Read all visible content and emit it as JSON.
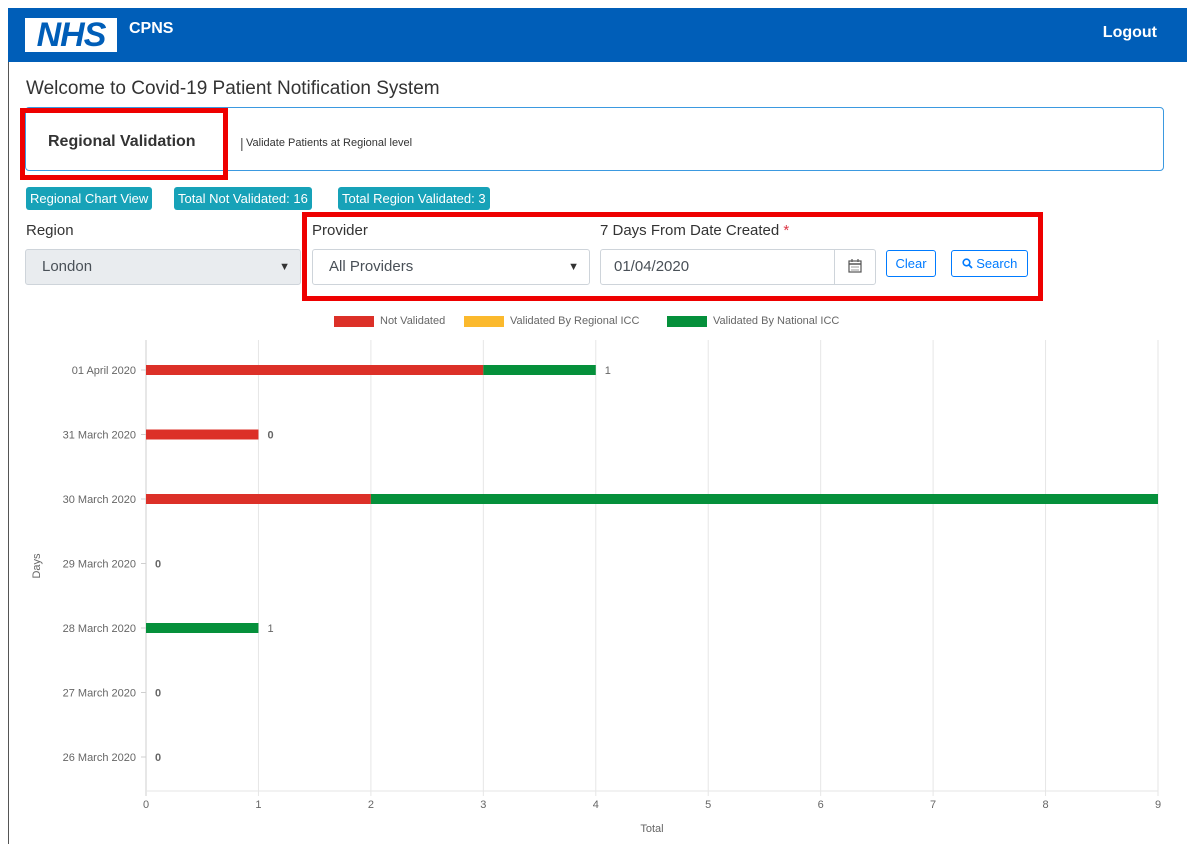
{
  "header": {
    "logo_text": "NHS",
    "app_name": "CPNS",
    "logout_label": "Logout",
    "bg_color": "#005eb8"
  },
  "page": {
    "welcome": "Welcome to Covid-19 Patient Notification System"
  },
  "panel": {
    "title": "Regional Validation",
    "separator": "|",
    "subtitle": "Validate Patients at Regional level"
  },
  "badges": {
    "chart_view": "Regional Chart View",
    "not_validated": "Total Not Validated: 16",
    "region_validated": "Total Region Validated: 3"
  },
  "filters": {
    "region_label": "Region",
    "region_value": "London",
    "provider_label": "Provider",
    "provider_value": "All Providers",
    "date_label": "7 Days From Date Created",
    "required_mark": "*",
    "date_value": "01/04/2020",
    "clear_label": "Clear",
    "search_label": "Search"
  },
  "chart_data": {
    "type": "bar",
    "orientation": "horizontal",
    "stacked": true,
    "categories": [
      "01 April 2020",
      "31 March 2020",
      "30 March 2020",
      "29 March 2020",
      "28 March 2020",
      "27 March 2020",
      "26 March 2020"
    ],
    "series": [
      {
        "name": "Not Validated",
        "color": "#dc3028",
        "values": [
          3,
          1,
          2,
          0,
          0,
          0,
          0
        ]
      },
      {
        "name": "Validated By Regional ICC",
        "color": "#fbb92d",
        "values": [
          0,
          0,
          0,
          0,
          0,
          0,
          0
        ]
      },
      {
        "name": "Validated By National ICC",
        "color": "#05903b",
        "values": [
          1,
          0,
          7,
          0,
          1,
          0,
          0
        ]
      }
    ],
    "end_labels": [
      "1",
      "0",
      "",
      "0",
      "1",
      "0",
      "0"
    ],
    "xlim": [
      0,
      9
    ],
    "x_ticks": [
      "0",
      "1",
      "2",
      "3",
      "4",
      "5",
      "6",
      "7",
      "8",
      "9"
    ],
    "xlabel": "Total",
    "ylabel": "Days",
    "grid": true,
    "legend_position": "top"
  }
}
